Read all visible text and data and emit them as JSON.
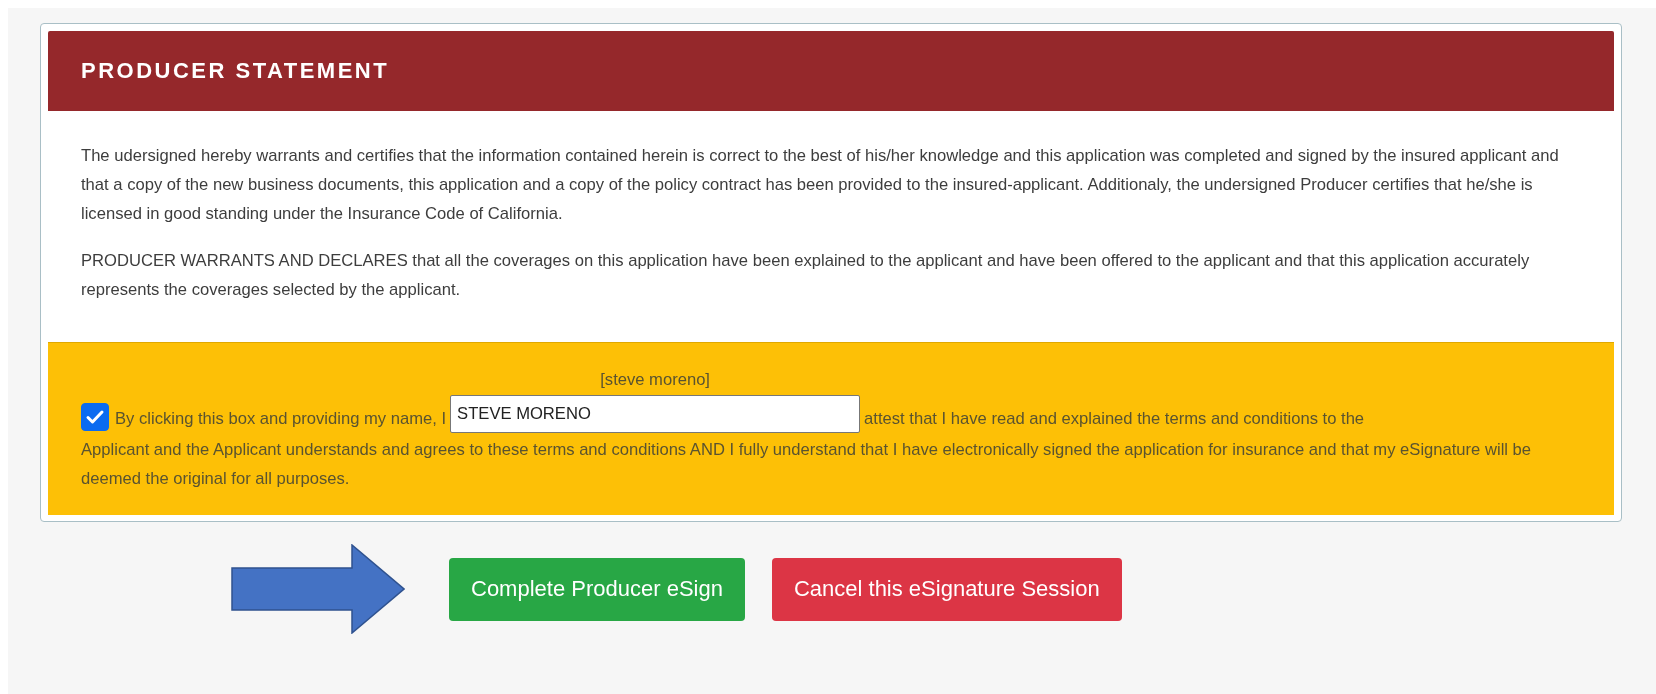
{
  "header": {
    "title": "PRODUCER STATEMENT"
  },
  "statement": {
    "paragraphs": [
      "The udersigned hereby warrants and certifies that the information contained herein is correct to the best of his/her knowledge and this application was completed and signed by the insured applicant and that a copy of the new business documents, this application and a copy of the policy contract has been provided to the insured-applicant. Additionaly, the undersigned Producer certifies that he/she is licensed in good standing under the Insurance Code of California.",
      "PRODUCER WARRANTS AND DECLARES that all the coverages on this application have been explained to the applicant and have been offered to the applicant and that this application accurately represents the coverages selected by the applicant."
    ]
  },
  "attestation": {
    "checked": true,
    "lead_text": "By clicking this box and providing my name, I",
    "name_label": "[steve moreno]",
    "name_value": "STEVE MORENO",
    "tail_text": "attest that I have read and explained the terms and conditions to the",
    "rest_text": "Applicant and the Applicant understands and agrees to these terms and conditions AND I fully understand that I have electronically signed the application for insurance and that my eSignature will be deemed the original for all purposes."
  },
  "buttons": [
    {
      "label": "Complete Producer eSign",
      "kind": "primary"
    },
    {
      "label": "Cancel this eSignature Session",
      "kind": "danger"
    }
  ]
}
